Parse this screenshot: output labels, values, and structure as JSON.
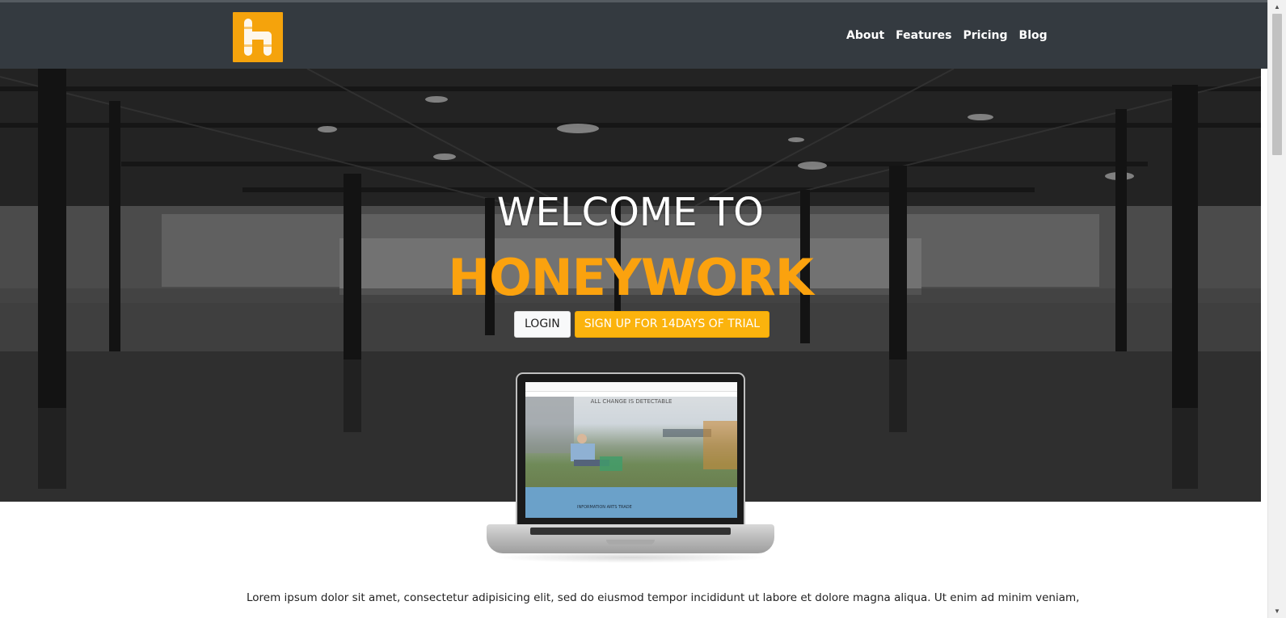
{
  "header": {
    "logo_icon": "honeywork-logo-icon",
    "nav": [
      {
        "label": "About"
      },
      {
        "label": "Features"
      },
      {
        "label": "Pricing"
      },
      {
        "label": "Blog"
      }
    ]
  },
  "hero": {
    "title_line_1": "WELCOME TO",
    "title_line_2": "HONEYWORK",
    "login_label": "LOGIN",
    "signup_label": "SIGN UP FOR 14DAYS OF TRIAL",
    "colors": {
      "accent": "#fba20e",
      "header_bg": "#343a40"
    }
  },
  "laptop_preview": {
    "screen_title": "ALL CHANGE IS DETECTABLE",
    "screen_section": "INFORMATION ARTS TRADE"
  },
  "content": {
    "intro_text": "Lorem ipsum dolor sit amet, consectetur adipisicing elit, sed do eiusmod tempor incididunt ut labore et dolore magna aliqua. Ut enim ad minim veniam,"
  }
}
